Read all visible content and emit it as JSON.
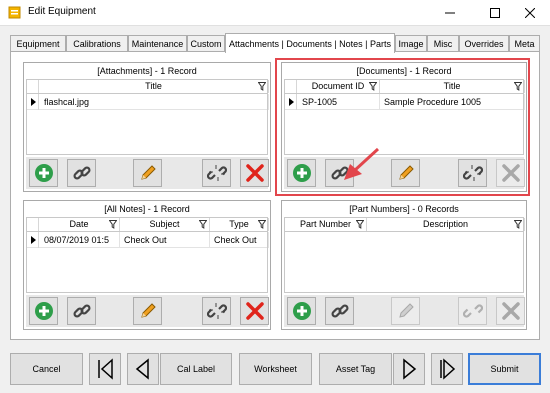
{
  "window": {
    "title": "Edit Equipment",
    "minimize_icon": "minimize-icon",
    "maximize_icon": "maximize-icon",
    "close_icon": "close-icon"
  },
  "tabs": [
    {
      "label": "Equipment"
    },
    {
      "label": "Calibrations"
    },
    {
      "label": "Maintenance"
    },
    {
      "label": "Custom"
    },
    {
      "label": "Attachments | Documents | Notes | Parts",
      "active": true
    },
    {
      "label": "Image"
    },
    {
      "label": "Misc"
    },
    {
      "label": "Overrides"
    },
    {
      "label": "Meta"
    }
  ],
  "attachments": {
    "caption": "[Attachments] - 1 Record",
    "columns": [
      "Title"
    ],
    "rows": [
      [
        "flashcal.jpg"
      ]
    ]
  },
  "documents": {
    "caption": "[Documents] - 1 Record",
    "columns": [
      "Document ID",
      "Title"
    ],
    "rows": [
      [
        "SP-1005",
        "Sample Procedure 1005"
      ]
    ]
  },
  "notes": {
    "caption": "[All Notes] - 1 Record",
    "columns": [
      "Date",
      "Subject",
      "Type"
    ],
    "rows": [
      [
        "08/07/2019 01:5",
        "Check Out",
        "Check Out"
      ]
    ]
  },
  "parts": {
    "caption": "[Part Numbers] - 0 Records",
    "columns": [
      "Part Number",
      "Description"
    ],
    "rows": []
  },
  "icons": {
    "add": "plus-circle-icon",
    "link": "chain-link-icon",
    "edit": "pencil-icon",
    "unlink": "broken-link-icon",
    "delete": "red-x-icon",
    "filter": "funnel-icon",
    "annotation": "red-arrow-annotation"
  },
  "colors": {
    "add_green": "#2e9e4a",
    "delete_red": "#e0241b",
    "pencil_orange": "#f0a020",
    "highlight_red": "#e2464c",
    "primary_border": "#3b7dd8"
  },
  "footer": {
    "cancel": "Cancel",
    "first_icon": "first-record-icon",
    "prev_icon": "previous-record-icon",
    "cal_label": "Cal Label",
    "worksheet": "Worksheet",
    "asset_tag": "Asset Tag",
    "next_icon": "next-record-icon",
    "last_icon": "last-record-icon",
    "submit": "Submit"
  }
}
